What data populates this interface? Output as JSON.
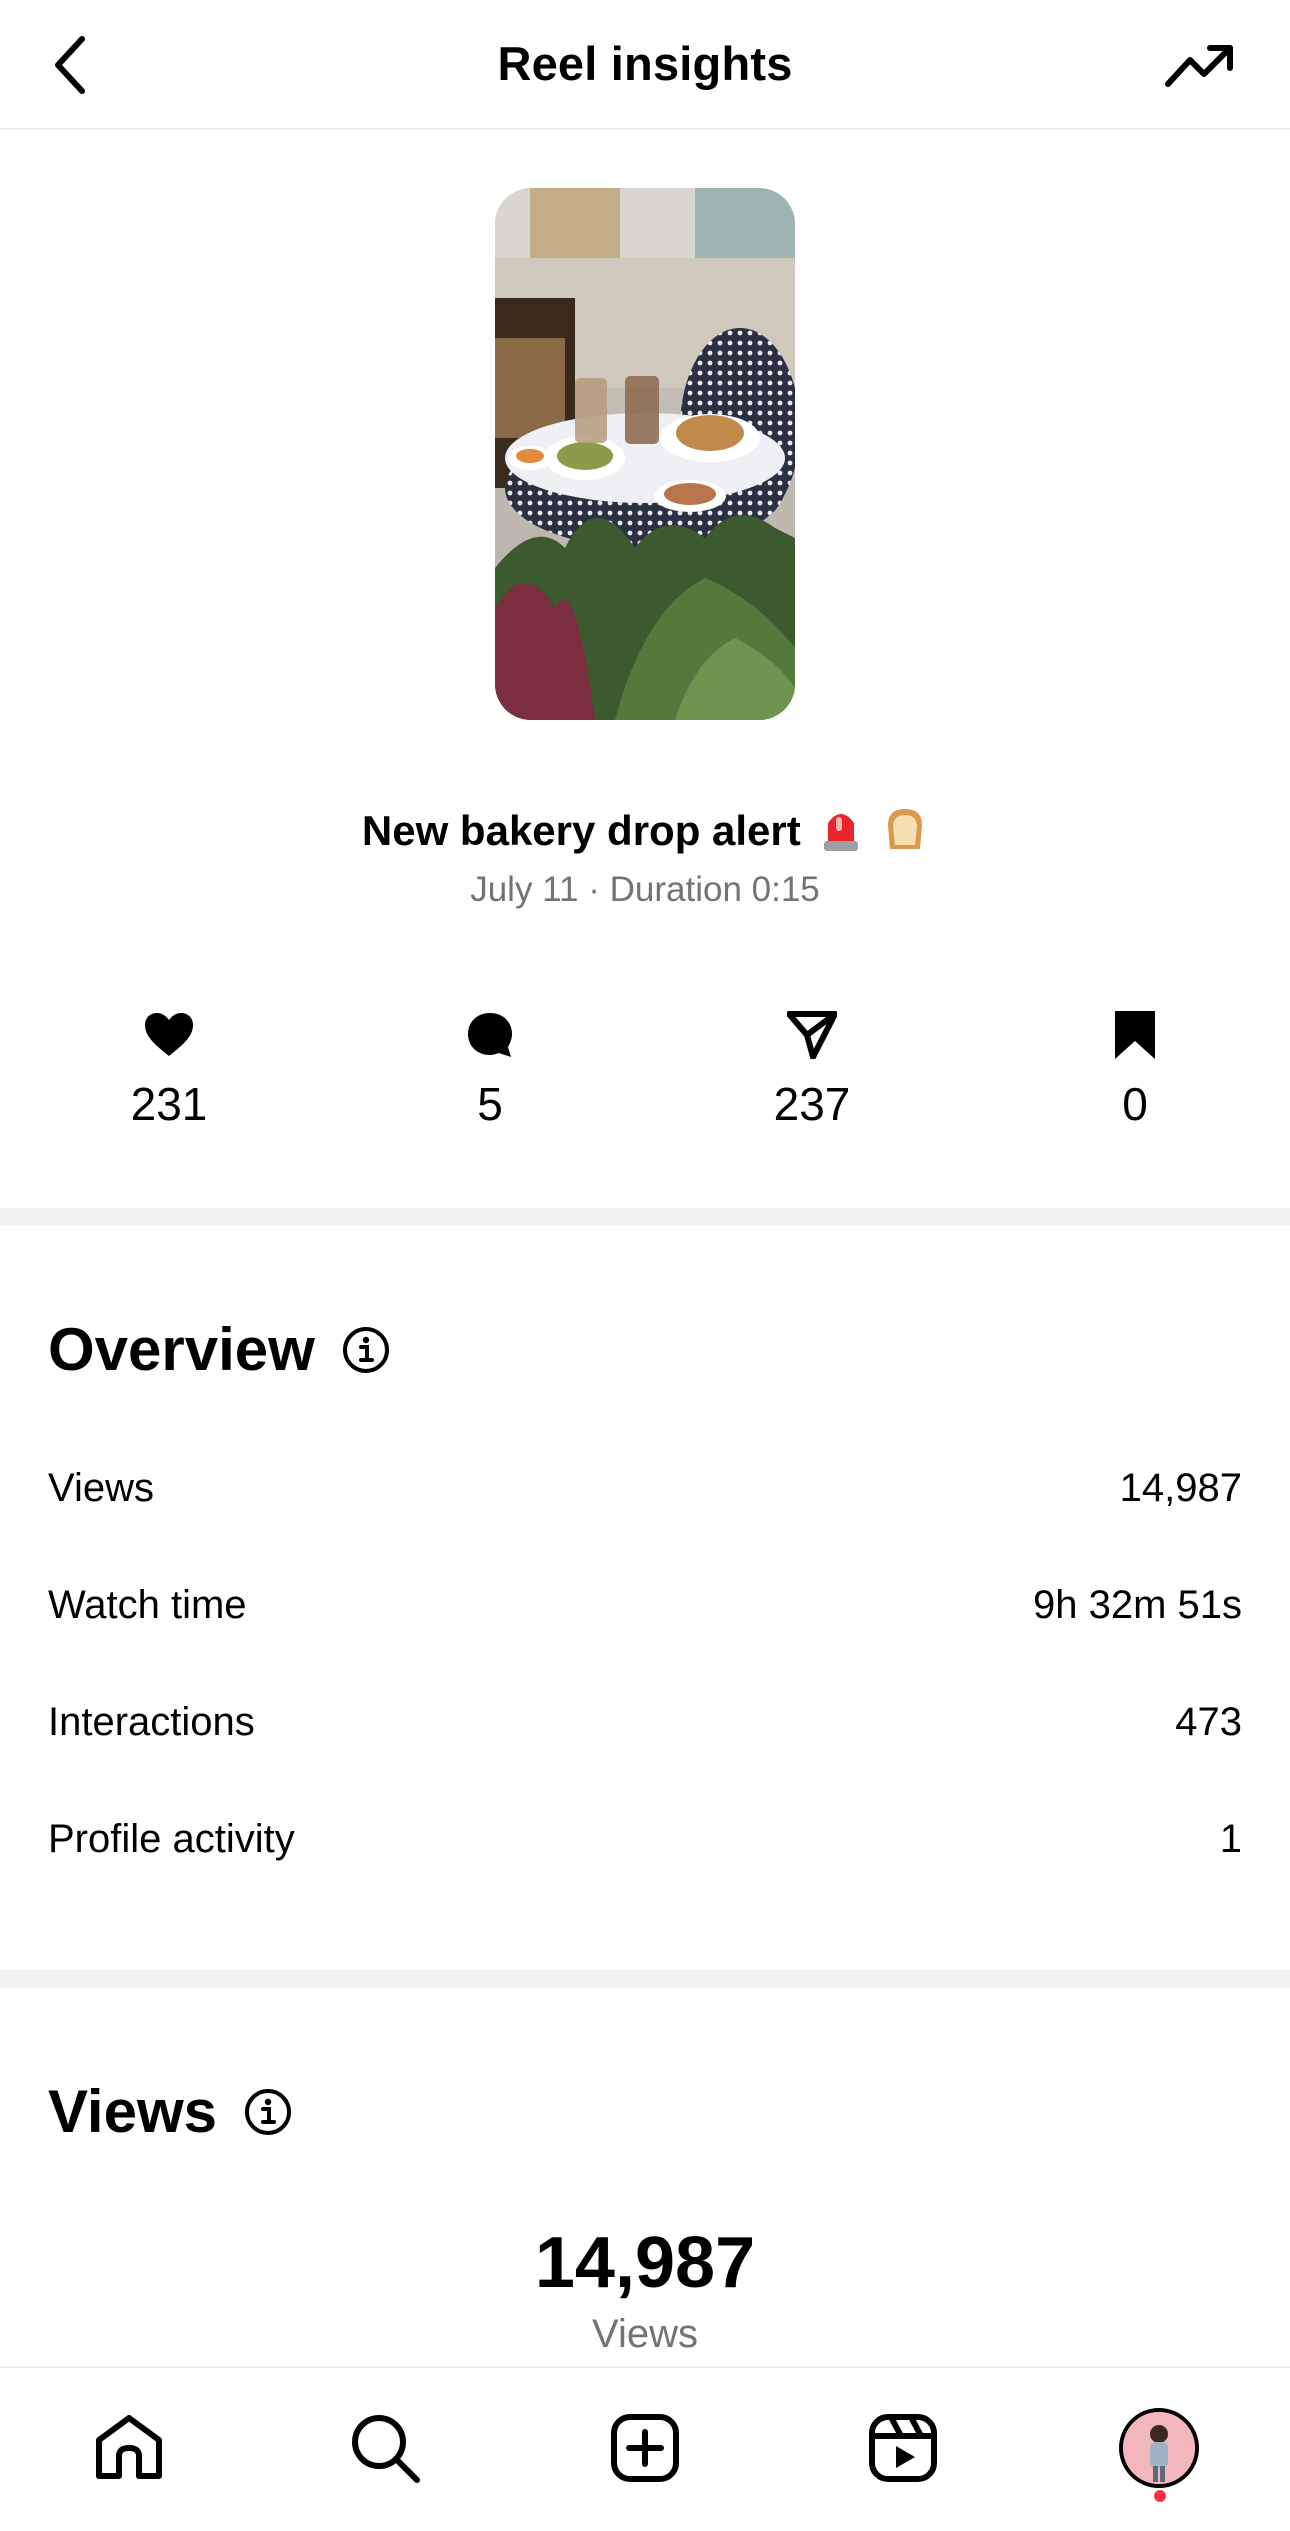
{
  "header": {
    "title": "Reel insights",
    "back_icon": "chevron-left-icon",
    "trend_icon": "trending-up-icon"
  },
  "reel": {
    "title": "New bakery drop alert",
    "emojis": [
      "rotating-light-emoji",
      "bread-emoji"
    ],
    "meta": "July 11 · Duration 0:15"
  },
  "stats": {
    "likes": "231",
    "comments": "5",
    "shares": "237",
    "saves": "0"
  },
  "overview": {
    "title": "Overview",
    "rows": [
      {
        "label": "Views",
        "value": "14,987"
      },
      {
        "label": "Watch time",
        "value": "9h 32m 51s"
      },
      {
        "label": "Interactions",
        "value": "473"
      },
      {
        "label": "Profile activity",
        "value": "1"
      }
    ]
  },
  "views": {
    "title": "Views",
    "total": "14,987",
    "total_label": "Views"
  },
  "bottom_nav": {
    "items": [
      "home-icon",
      "search-icon",
      "create-icon",
      "reels-icon",
      "profile-avatar"
    ]
  },
  "colors": {
    "secondary_text": "#737373",
    "divider": "#f2f2f2",
    "notification": "#ff3040"
  }
}
